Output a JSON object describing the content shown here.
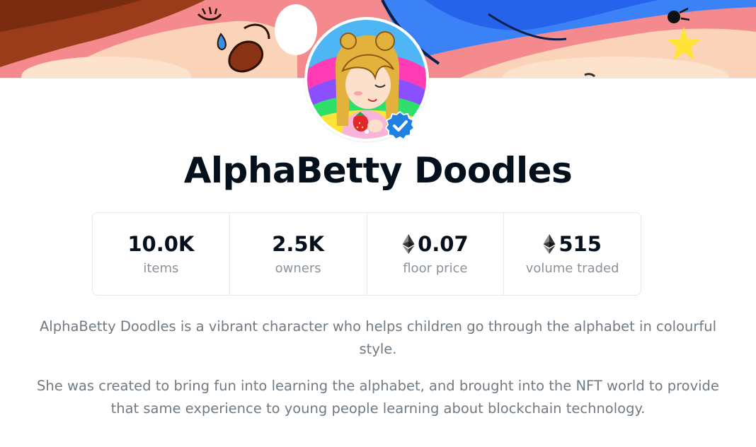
{
  "collection": {
    "name": "AlphaBetty Doodles",
    "verified": true
  },
  "stats": [
    {
      "value": "10.0K",
      "label": "items",
      "currency_icon": null
    },
    {
      "value": "2.5K",
      "label": "owners",
      "currency_icon": null
    },
    {
      "value": "0.07",
      "label": "floor price",
      "currency_icon": "ethereum-icon"
    },
    {
      "value": "515",
      "label": "volume traded",
      "currency_icon": "ethereum-icon"
    }
  ],
  "description": {
    "paragraph_1": "AlphaBetty Doodles is a vibrant character who helps children go through the alphabet in colourful style.",
    "paragraph_2": "She was created to bring fun into learning the alphabet, and brought into the NFT world to provide that same experience to young people learning about blockchain technology."
  },
  "colors": {
    "title_text": "#04111d",
    "muted_text": "#707a83",
    "label_text": "#8a939b",
    "border": "#e5e8eb",
    "verified_badge": "#2081e2"
  }
}
